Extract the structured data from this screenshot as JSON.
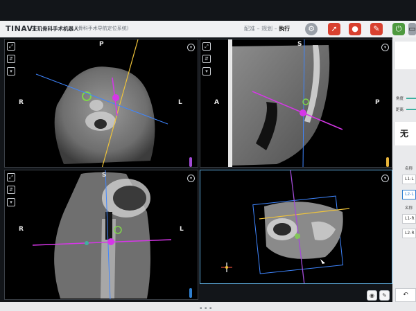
{
  "app": {
    "brand": "TINAVI",
    "product": "天玑骨科手术机器人",
    "subproduct": "(骨科手术导航定位系统)"
  },
  "workflow": {
    "steps": [
      "配准",
      "规划",
      "执行"
    ],
    "separator": " – ",
    "active_step": "执行"
  },
  "toolbar": {
    "buttons": [
      {
        "name": "settings-button",
        "icon": "gear-icon",
        "color": "#9aa0a8"
      },
      {
        "name": "robot-arm-button",
        "icon": "robot-arm-icon",
        "color": "#d8402f"
      },
      {
        "name": "patient-button",
        "icon": "person-icon",
        "color": "#d8402f"
      },
      {
        "name": "tool-button",
        "icon": "wrench-icon",
        "color": "#d8402f"
      },
      {
        "name": "power-button",
        "icon": "power-icon",
        "color": "#4e9a3f"
      },
      {
        "name": "window-button",
        "icon": "window-icon",
        "color": "#9aa0a8"
      }
    ]
  },
  "views": {
    "axial": {
      "top": "P",
      "left": "R",
      "right": "L",
      "chip_color": "#a24bd6"
    },
    "sagittal": {
      "top": "S",
      "left": "A",
      "right": "P",
      "chip_color": "#e7b43a"
    },
    "coronal": {
      "top": "S",
      "left": "R",
      "right": "L",
      "chip_color": "#2f7fd0"
    },
    "volume": {}
  },
  "sidebar": {
    "group1_label": "名称",
    "group2_label": "名称",
    "items_top": [
      "L1-L",
      "L2-L"
    ],
    "items_bottom": [
      "L1-R",
      "L2-R"
    ],
    "selected": "L2-L",
    "row_labels": [
      "角度",
      "距离"
    ],
    "caption": "无",
    "stat_label": "穿刺距离"
  },
  "colors": {
    "magenta_line": "#d636e8",
    "blue_line": "#3f86ff",
    "yellow_line": "#f0c43a",
    "accent": "#2f7fd0"
  }
}
